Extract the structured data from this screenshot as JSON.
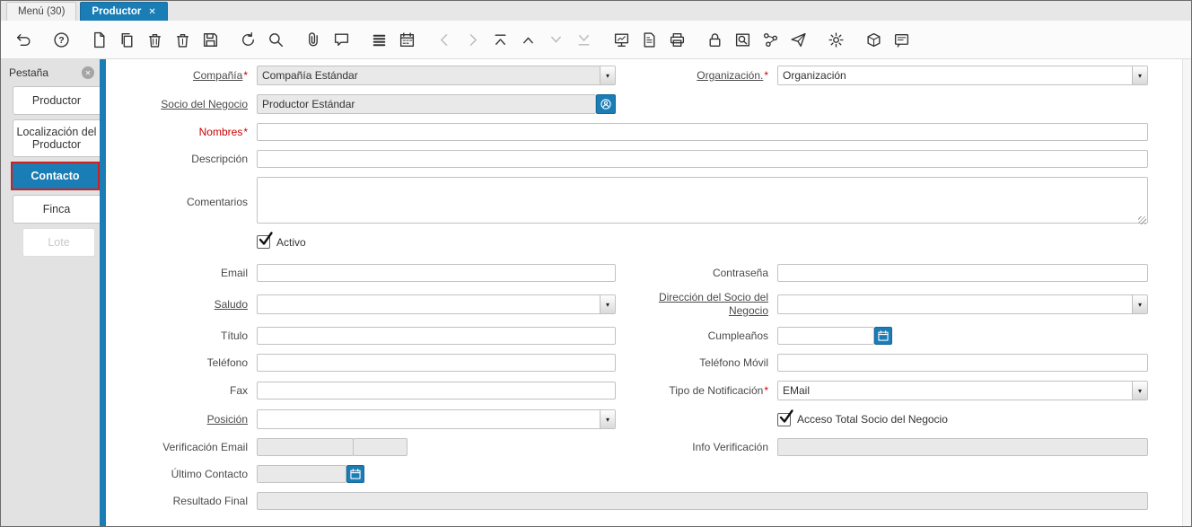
{
  "window": {
    "tabs": [
      {
        "label": "Menú (30)"
      },
      {
        "label": "Productor"
      }
    ]
  },
  "ui": {
    "close_glyph": "✕",
    "collapse_glyph": "✕",
    "dropdown_glyph": "▾",
    "required_marker": "*"
  },
  "colors": {
    "accent_blue": "#1a7db6",
    "highlight_red": "#cc2222",
    "readonly_gray": "#e9e9e9"
  },
  "toolbar": {
    "icons": [
      {
        "name": "undo"
      },
      {
        "name": "help",
        "gap": true
      },
      {
        "name": "new-record",
        "gap": true
      },
      {
        "name": "copy-record"
      },
      {
        "name": "delete-record"
      },
      {
        "name": "delete-selection"
      },
      {
        "name": "save"
      },
      {
        "name": "requery",
        "gap": true
      },
      {
        "name": "find"
      },
      {
        "name": "attachment",
        "gap": true
      },
      {
        "name": "chat"
      },
      {
        "name": "grid-toggle",
        "gap": true
      },
      {
        "name": "calendar"
      },
      {
        "name": "nav-left",
        "gap": true,
        "enabled": false
      },
      {
        "name": "nav-right",
        "enabled": false
      },
      {
        "name": "first-record"
      },
      {
        "name": "previous-record"
      },
      {
        "name": "next-record",
        "enabled": false
      },
      {
        "name": "last-record",
        "enabled": false
      },
      {
        "name": "report-view",
        "gap": true
      },
      {
        "name": "archive"
      },
      {
        "name": "print"
      },
      {
        "name": "private-lock",
        "gap": true
      },
      {
        "name": "zoom-across"
      },
      {
        "name": "workflow"
      },
      {
        "name": "request"
      },
      {
        "name": "preference",
        "gap": true
      },
      {
        "name": "product-info",
        "gap": true
      },
      {
        "name": "log"
      }
    ]
  },
  "sidebar": {
    "header": "Pestaña",
    "tabs": [
      {
        "id": "productor",
        "label": "Productor",
        "state": "normal"
      },
      {
        "id": "localizacion-del-productor",
        "label": "Localización del Productor",
        "state": "normal"
      },
      {
        "id": "contacto",
        "label": "Contacto",
        "state": "active"
      },
      {
        "id": "finca",
        "label": "Finca",
        "state": "normal"
      },
      {
        "id": "lote",
        "label": "Lote",
        "state": "disabled"
      }
    ]
  },
  "form": {
    "compania": {
      "label": "Compañía",
      "value": "Compañía Estándar"
    },
    "organizacion": {
      "label": "Organización.",
      "value": "Organización"
    },
    "socio_negocio": {
      "label": "Socio del Negocio",
      "value": "Productor Estándar"
    },
    "nombres": {
      "label": "Nombres",
      "value": ""
    },
    "descripcion": {
      "label": "Descripción",
      "value": ""
    },
    "comentarios": {
      "label": "Comentarios",
      "value": ""
    },
    "activo": {
      "label": "Activo",
      "checked": true
    },
    "email": {
      "label": "Email",
      "value": ""
    },
    "contrasena": {
      "label": "Contraseña",
      "value": ""
    },
    "saludo": {
      "label": "Saludo",
      "value": ""
    },
    "direccion_socio": {
      "label": "Dirección del Socio del Negocio",
      "value": ""
    },
    "titulo": {
      "label": "Título",
      "value": ""
    },
    "cumpleanos": {
      "label": "Cumpleaños",
      "value": ""
    },
    "telefono": {
      "label": "Teléfono",
      "value": ""
    },
    "telefono_movil": {
      "label": "Teléfono Móvil",
      "value": ""
    },
    "fax": {
      "label": "Fax",
      "value": ""
    },
    "tipo_notificacion": {
      "label": "Tipo de Notificación",
      "value": "EMail"
    },
    "posicion": {
      "label": "Posición",
      "value": ""
    },
    "acceso_total": {
      "label": "Acceso Total Socio del Negocio",
      "checked": true
    },
    "verificacion_email": {
      "label": "Verificación Email",
      "value": "",
      "value2": ""
    },
    "info_verificacion": {
      "label": "Info Verificación",
      "value": ""
    },
    "ultimo_contacto": {
      "label": "Último Contacto",
      "value": ""
    },
    "resultado_final": {
      "label": "Resultado Final",
      "value": ""
    }
  }
}
